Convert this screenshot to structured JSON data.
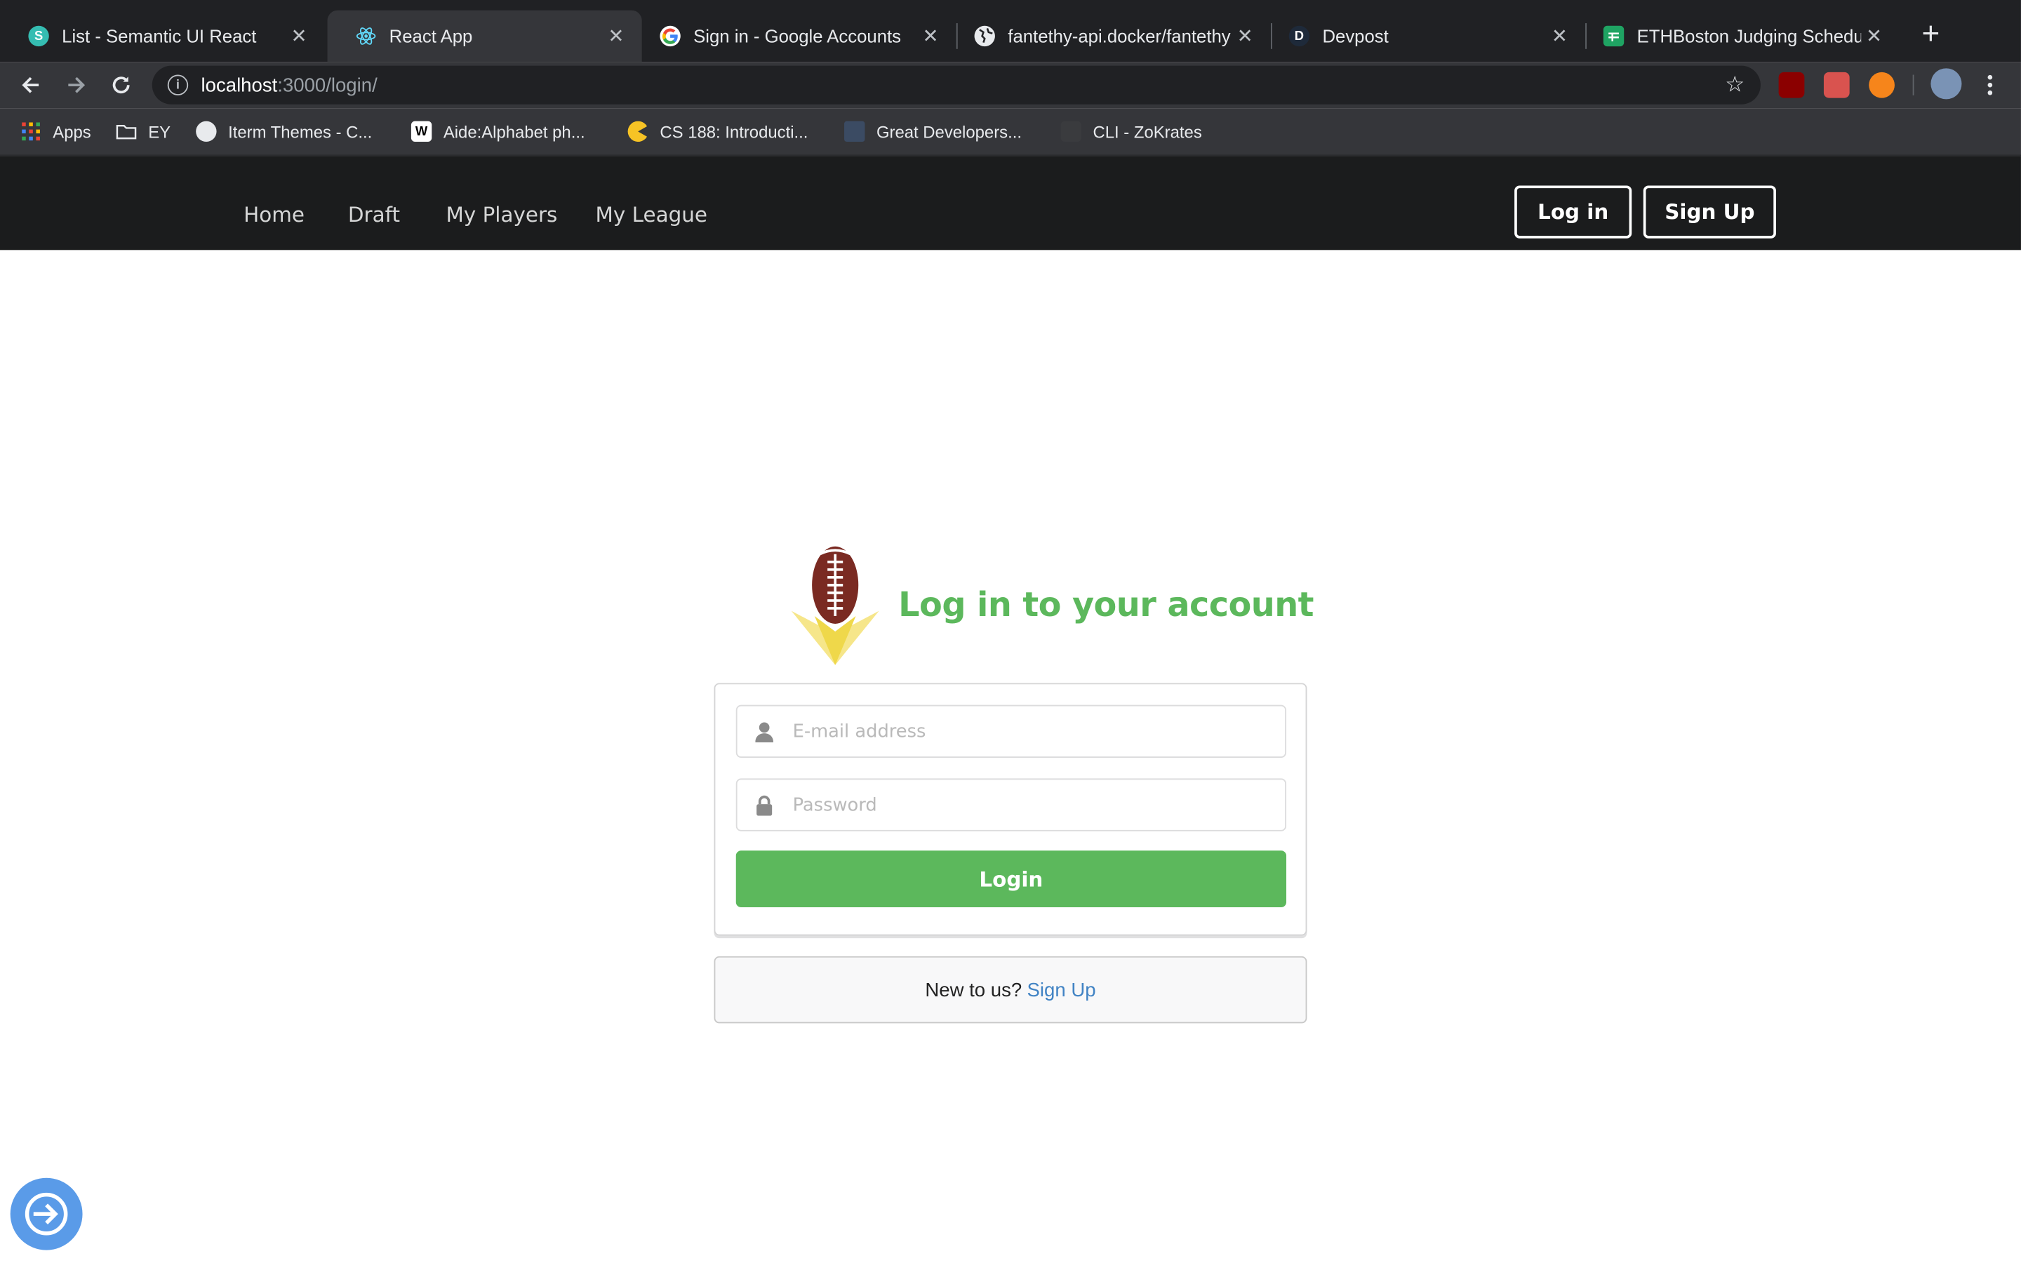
{
  "browser": {
    "tabs": [
      {
        "title": "List - Semantic UI React",
        "active": false
      },
      {
        "title": "React App",
        "active": true
      },
      {
        "title": "Sign in - Google Accounts",
        "active": false
      },
      {
        "title": "fantethy-api.docker/fantethy",
        "active": false
      },
      {
        "title": "Devpost",
        "active": false
      },
      {
        "title": "ETHBoston Judging Schedule",
        "active": false
      }
    ],
    "url_host": "localhost",
    "url_path": ":3000/login/",
    "bookmarks": [
      {
        "label": "Apps"
      },
      {
        "label": "EY"
      },
      {
        "label": "Iterm Themes - C..."
      },
      {
        "label": "Aide:Alphabet ph..."
      },
      {
        "label": "CS 188: Introducti..."
      },
      {
        "label": "Great Developers..."
      },
      {
        "label": "CLI - ZoKrates"
      }
    ]
  },
  "navbar": {
    "items": [
      "Home",
      "Draft",
      "My Players",
      "My League"
    ],
    "login_label": "Log in",
    "signup_label": "Sign Up"
  },
  "login": {
    "heading": "Log in to your account",
    "email_placeholder": "E-mail address",
    "password_placeholder": "Password",
    "button_label": "Login",
    "new_prompt": "New to us?",
    "signup_link": "Sign Up"
  },
  "colors": {
    "accent_green": "#5cb85c",
    "link_blue": "#4183c4",
    "nav_bg": "#1b1c1d"
  }
}
